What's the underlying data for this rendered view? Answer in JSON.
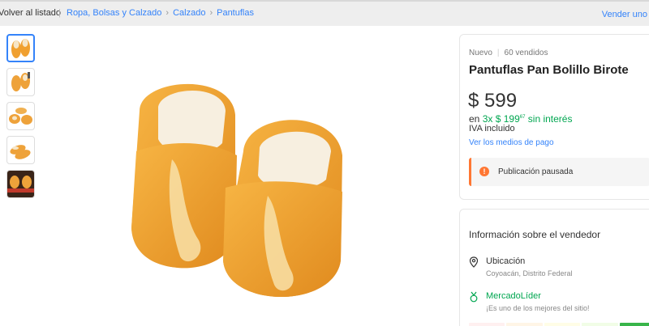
{
  "topbar": {
    "back_label": "Volver al listado",
    "separator": "|",
    "breadcrumbs": [
      "Ropa, Bolsas y Calzado",
      "Calzado",
      "Pantuflas"
    ],
    "sell_label": "Vender uno"
  },
  "gallery": {
    "thumbnail_count": 5,
    "active_index": 0
  },
  "product": {
    "condition": "Nuevo",
    "sold": "60 vendidos",
    "title": "Pantuflas Pan Bolillo Birote",
    "price": "$ 599",
    "installments_prefix": "en",
    "installments_main": "3x $ 199",
    "installments_cents": "67",
    "installments_suffix": "sin interés",
    "tax": "IVA incluido",
    "payment_link": "Ver los medios de pago",
    "status": "Publicación pausada"
  },
  "seller": {
    "heading": "Información sobre el vendedor",
    "location_label": "Ubicación",
    "location_value": "Coyoacán, Distrito Federal",
    "leader_label": "MercadoLíder",
    "leader_desc": "¡Es uno de los mejores del sitio!",
    "reputation_colors": [
      "#fff0f0",
      "#fff5e6",
      "#fffde6",
      "#f1fde6",
      "#39b54a"
    ]
  },
  "colors": {
    "link": "#3483fa",
    "green": "#00a650",
    "warning": "#ff7733"
  }
}
